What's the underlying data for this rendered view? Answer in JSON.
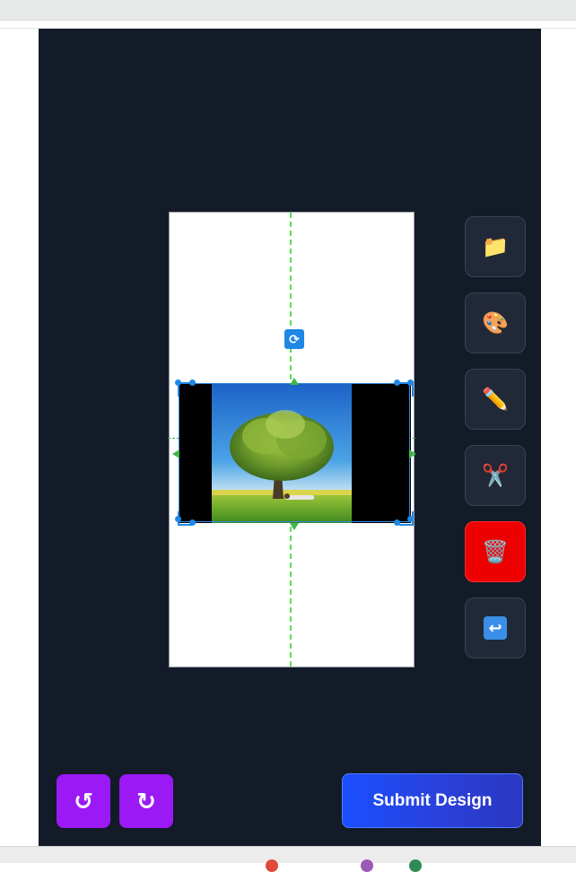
{
  "app": {
    "tools": [
      {
        "name": "folder-icon",
        "glyph": "📁",
        "label": "Open files"
      },
      {
        "name": "palette-icon",
        "glyph": "🎨",
        "label": "Colors"
      },
      {
        "name": "pencil-icon",
        "glyph": "✏️",
        "label": "Draw"
      },
      {
        "name": "scissors-icon",
        "glyph": "✂️",
        "label": "Crop"
      },
      {
        "name": "trash-icon",
        "glyph": "🗑️",
        "label": "Delete"
      },
      {
        "name": "return-icon",
        "glyph": "↩",
        "label": "Back"
      }
    ],
    "undo_glyph": "↺",
    "redo_glyph": "↻",
    "submit_label": "Submit Design",
    "rotate_glyph": "⟳"
  },
  "colors": {
    "background": "#131a28",
    "tool_button": "#212938",
    "delete_button": "#ee0000",
    "undo_redo": "#9b19f5",
    "submit_gradient_start": "#1a4fff",
    "guide_line": "#58e058",
    "selection": "#1e88e5"
  }
}
